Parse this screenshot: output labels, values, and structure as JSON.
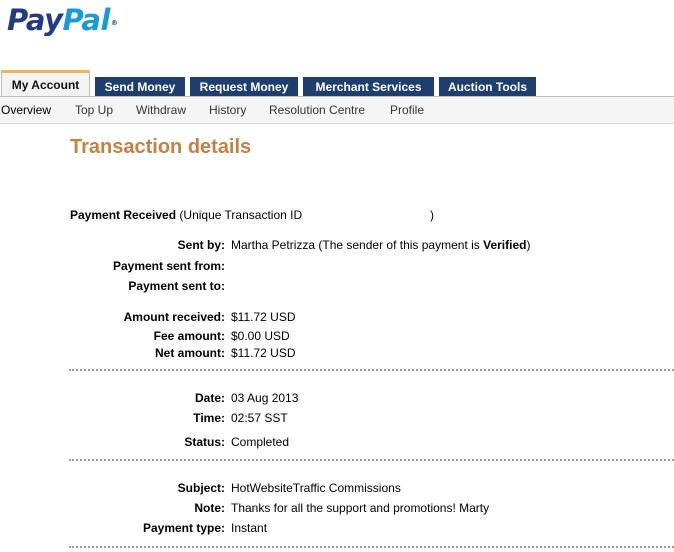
{
  "brand": {
    "pay": "Pay",
    "pal": "Pal",
    "tm": "®"
  },
  "tabs": [
    {
      "label": "My Account"
    },
    {
      "label": "Send Money"
    },
    {
      "label": "Request Money"
    },
    {
      "label": "Merchant Services"
    },
    {
      "label": "Auction Tools"
    }
  ],
  "subnav": [
    {
      "label": "Overview"
    },
    {
      "label": "Top Up"
    },
    {
      "label": "Withdraw"
    },
    {
      "label": "History"
    },
    {
      "label": "Resolution Centre"
    },
    {
      "label": "Profile"
    }
  ],
  "page_title": "Transaction details",
  "payment_header": {
    "type": "Payment Received",
    "id_prefix": "(Unique Transaction ID",
    "id_suffix": ")"
  },
  "sender": {
    "label": "Sent by:",
    "name_text": "Martha Petrizza (The sender of this payment is ",
    "verified": "Verified",
    "close": ")"
  },
  "sent_from": {
    "label": "Payment sent from:",
    "value": ""
  },
  "sent_to": {
    "label": "Payment sent to:",
    "value": ""
  },
  "amounts": {
    "received_label": "Amount received:",
    "received": "$11.72 USD",
    "fee_label": "Fee amount:",
    "fee": "$0.00 USD",
    "net_label": "Net amount:",
    "net": "$11.72 USD"
  },
  "timing": {
    "date_label": "Date:",
    "date": "03 Aug 2013",
    "time_label": "Time:",
    "time": "02:57 SST",
    "status_label": "Status:",
    "status": "Completed"
  },
  "details": {
    "subject_label": "Subject:",
    "subject": "HotWebsiteTraffic Commissions",
    "note_label": "Note:",
    "note": "Thanks for all the support and promotions! Marty",
    "type_label": "Payment type:",
    "type": "Instant"
  }
}
